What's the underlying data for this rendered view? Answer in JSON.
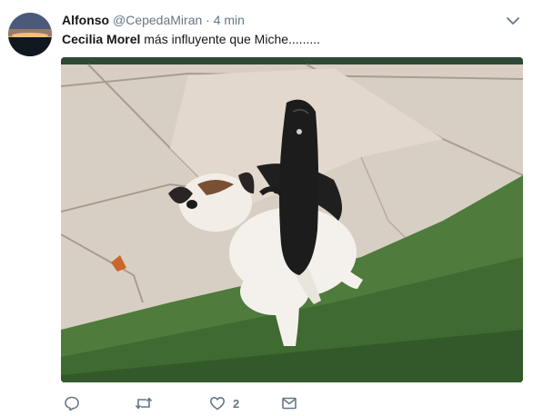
{
  "tweet": {
    "author_name": "Alfonso",
    "author_handle": "@CepedaMiran",
    "separator": "·",
    "time": "4 min",
    "mention": "Cecilia Morel",
    "body": " más influyente que Miche.........",
    "media_description": "dog flipping sandal",
    "actions": {
      "reply_icon": "reply-icon",
      "retweet_icon": "retweet-icon",
      "like_icon": "heart-icon",
      "like_count": "2",
      "dm_icon": "envelope-icon"
    }
  },
  "colors": {
    "text": "#14171a",
    "secondary": "#657786",
    "icon": "#657786"
  }
}
